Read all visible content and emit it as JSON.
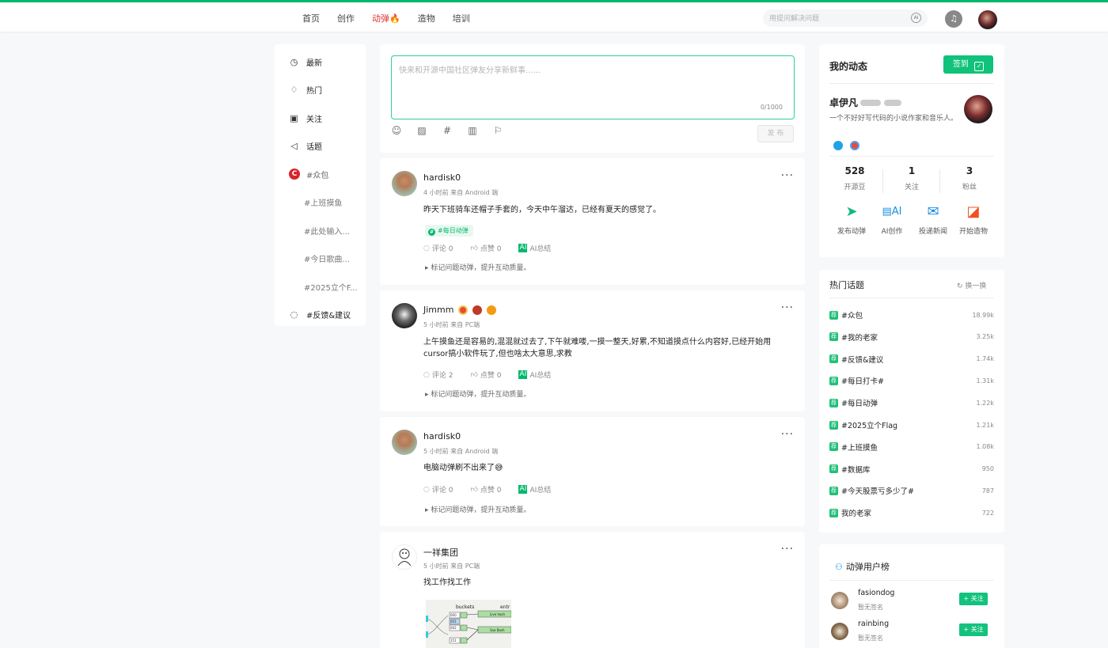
{
  "topnav": {
    "items": [
      "首页",
      "创作",
      "动弹🔥",
      "造物",
      "培训"
    ],
    "active_index": 2,
    "search_placeholder": "用提问解决问题",
    "search_ai": "AI"
  },
  "leftnav": {
    "main": [
      {
        "label": "最新",
        "icon": "clock-icon"
      },
      {
        "label": "热门",
        "icon": "flame-icon"
      },
      {
        "label": "关注",
        "icon": "follow-icon"
      },
      {
        "label": "话题",
        "icon": "megaphone-icon"
      }
    ],
    "community": {
      "label": "#众包",
      "logo": "C"
    },
    "topics": [
      "#上班摸鱼",
      "#此处输入...",
      "#今日歌曲...",
      "#2025立个F..."
    ],
    "feedback": {
      "label": "#反馈&建议",
      "icon": "chat-icon"
    }
  },
  "composer": {
    "placeholder": "快来和开源中国社区弹友分享新鲜事......",
    "counter": "0/1000",
    "publish": "发 布",
    "tools": [
      "emoji-icon",
      "image-icon",
      "hashtag-icon",
      "chart-icon",
      "flag-icon"
    ]
  },
  "posts": [
    {
      "author": "hardisk0",
      "meta": "4 小时前 来自 Android 端",
      "text": "昨天下班骑车还帽子手套的，今天中午溜达，已经有夏天的感觉了。",
      "tag": "#每日动弹",
      "comments": "评论 0",
      "likes": "点赞 0",
      "ai": "AI总结",
      "hint": "标记问题动弹，提升互动质量。"
    },
    {
      "author": "Jimmm",
      "meta": "5 小时前 来自 PC端",
      "text": "上午摸鱼还是容易的,混混就过去了,下午就难喽,一摸一整天,好累,不知道摸点什么内容好,已经开始用cursor搞小软件玩了,但也啥太大意思,求教",
      "comments": "评论 2",
      "likes": "点赞 0",
      "ai": "AI总结",
      "hint": "标记问题动弹，提升互动质量。"
    },
    {
      "author": "hardisk0",
      "meta": "5 小时前 来自 Android 端",
      "text": "电脑动弹刷不出来了😅",
      "comments": "评论 0",
      "likes": "点赞 0",
      "ai": "AI总结",
      "hint": "标记问题动弹，提升互动质量。"
    },
    {
      "author": "一祥集团",
      "meta": "5 小时前 来自 PC端",
      "text": "找工作找工作",
      "image_labels": [
        "buckets",
        "entr",
        "000",
        "001",
        "002",
        "151",
        "Live hash",
        "Saa Bash"
      ]
    }
  ],
  "profile": {
    "title": "我的动态",
    "sign": "签到",
    "name": "卓伊凡",
    "bio": "一个不好好写代码的小说作家和音乐人。",
    "stats": [
      {
        "n": "528",
        "l": "开源豆"
      },
      {
        "n": "1",
        "l": "关注"
      },
      {
        "n": "3",
        "l": "粉丝"
      }
    ],
    "actions": [
      "发布动弹",
      "AI创作",
      "投递新闻",
      "开始造物"
    ]
  },
  "hot_topics": {
    "title": "热门话题",
    "swap": "换一换",
    "badge": "荐",
    "items": [
      {
        "name": "#众包",
        "v": "18.99k"
      },
      {
        "name": "#我的老家",
        "v": "3.25k"
      },
      {
        "name": "#反馈&建议",
        "v": "1.74k"
      },
      {
        "name": "#每日打卡#",
        "v": "1.31k"
      },
      {
        "name": "#每日动弹",
        "v": "1.22k"
      },
      {
        "name": "#2025立个Flag",
        "v": "1.21k"
      },
      {
        "name": "#上班摸鱼",
        "v": "1.08k"
      },
      {
        "name": "#数据库",
        "v": "950"
      },
      {
        "name": "#今天股票亏多少了#",
        "v": "787"
      },
      {
        "name": "我的老家",
        "v": "722"
      }
    ]
  },
  "rank": {
    "title": "动弹用户榜",
    "follow": "+ 关注",
    "users": [
      {
        "name": "fasiondog",
        "sig": "暂无签名"
      },
      {
        "name": "rainbing",
        "sig": "暂无签名"
      }
    ]
  },
  "colors": {
    "brand": "#00b86b",
    "active_nav": "#e0322d"
  }
}
